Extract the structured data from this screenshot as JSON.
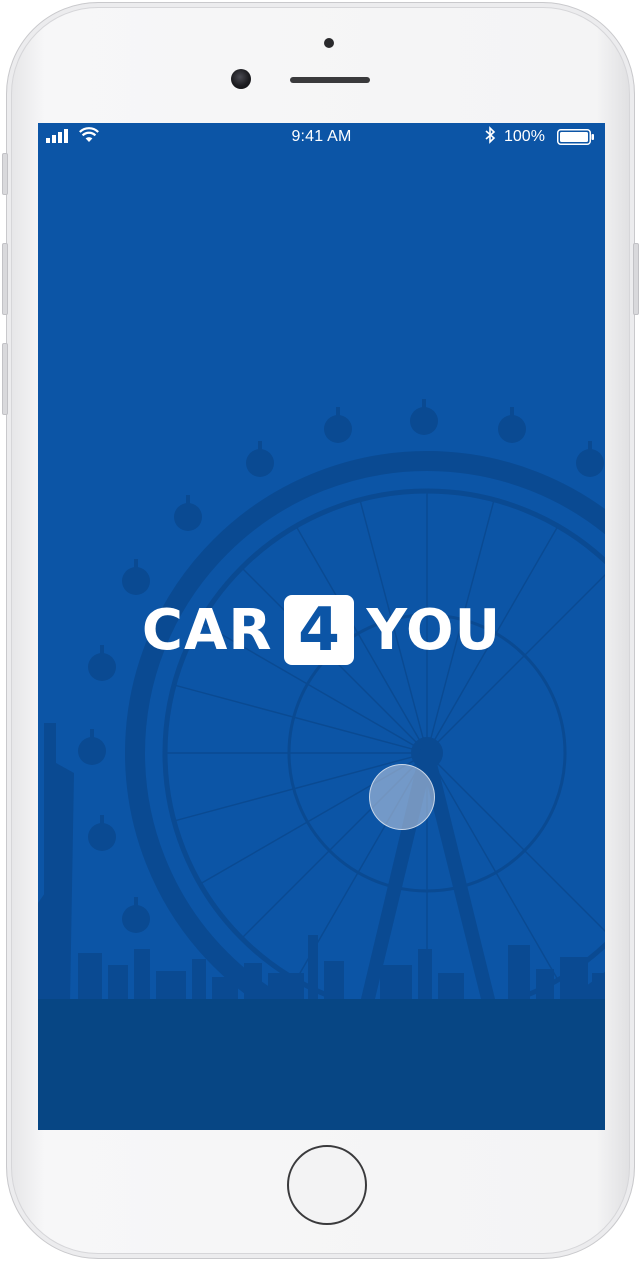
{
  "status_bar": {
    "time": "9:41 AM",
    "battery": "100%",
    "icons": [
      "signal-bars-icon",
      "wifi-icon",
      "bluetooth-icon",
      "battery-icon"
    ]
  },
  "splash": {
    "logo_left": "CAR",
    "logo_badge": "4",
    "logo_right": "YOU",
    "background_art": "ferris-wheel-skyline-silhouette"
  },
  "colors": {
    "screen_background": "#0c55a6",
    "silhouette": "#0a4a92",
    "ground": "#074684",
    "logo_text": "#ffffff",
    "badge_background": "#ffffff",
    "badge_text": "#0c55a6"
  }
}
